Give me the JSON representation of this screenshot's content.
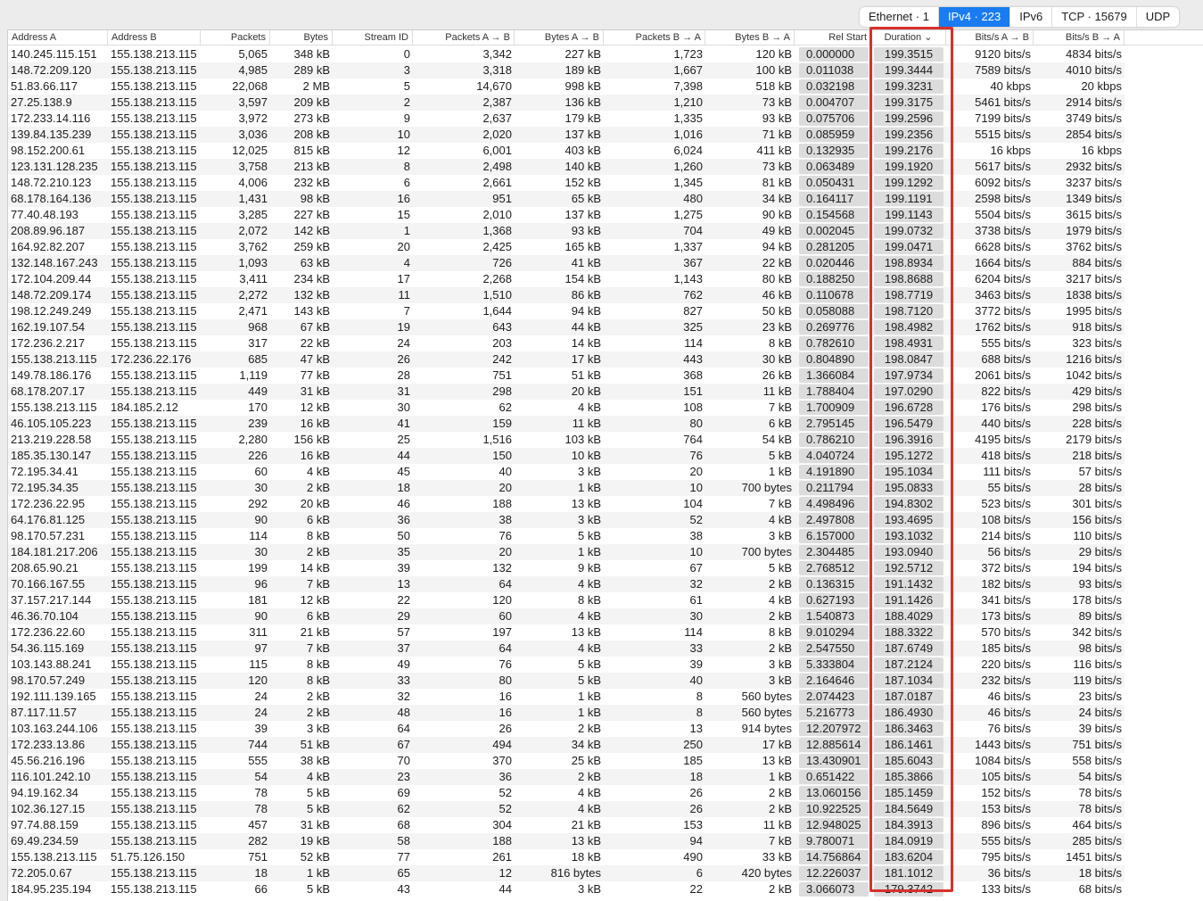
{
  "tabs": [
    {
      "label": "Ethernet · 1",
      "active": false
    },
    {
      "label": "IPv4 · 223",
      "active": true
    },
    {
      "label": "IPv6",
      "active": false
    },
    {
      "label": "TCP · 15679",
      "active": false
    },
    {
      "label": "UDP",
      "active": false
    }
  ],
  "accent": "#1a7cf0",
  "highlight_color": "#d9302c",
  "columns": [
    "Address A",
    "Address B",
    "Packets",
    "Bytes",
    "Stream ID",
    "Packets A → B",
    "Bytes A → B",
    "Packets B → A",
    "Bytes B → A",
    "Rel Start",
    "Duration ⌄",
    "Bits/s A → B",
    "Bits/s B → A"
  ],
  "rows": [
    [
      "140.245.115.151",
      "155.138.213.115",
      "5,065",
      "348 kB",
      "0",
      "3,342",
      "227 kB",
      "1,723",
      "120 kB",
      "0.000000",
      "199.3515",
      "9120 bits/s",
      "4834 bits/s"
    ],
    [
      "148.72.209.120",
      "155.138.213.115",
      "4,985",
      "289 kB",
      "3",
      "3,318",
      "189 kB",
      "1,667",
      "100 kB",
      "0.011038",
      "199.3444",
      "7589 bits/s",
      "4010 bits/s"
    ],
    [
      "51.83.66.117",
      "155.138.213.115",
      "22,068",
      "2 MB",
      "5",
      "14,670",
      "998 kB",
      "7,398",
      "518 kB",
      "0.032198",
      "199.3231",
      "40 kbps",
      "20 kbps"
    ],
    [
      "27.25.138.9",
      "155.138.213.115",
      "3,597",
      "209 kB",
      "2",
      "2,387",
      "136 kB",
      "1,210",
      "73 kB",
      "0.004707",
      "199.3175",
      "5461 bits/s",
      "2914 bits/s"
    ],
    [
      "172.233.14.116",
      "155.138.213.115",
      "3,972",
      "273 kB",
      "9",
      "2,637",
      "179 kB",
      "1,335",
      "93 kB",
      "0.075706",
      "199.2596",
      "7199 bits/s",
      "3749 bits/s"
    ],
    [
      "139.84.135.239",
      "155.138.213.115",
      "3,036",
      "208 kB",
      "10",
      "2,020",
      "137 kB",
      "1,016",
      "71 kB",
      "0.085959",
      "199.2356",
      "5515 bits/s",
      "2854 bits/s"
    ],
    [
      "98.152.200.61",
      "155.138.213.115",
      "12,025",
      "815 kB",
      "12",
      "6,001",
      "403 kB",
      "6,024",
      "411 kB",
      "0.132935",
      "199.2176",
      "16 kbps",
      "16 kbps"
    ],
    [
      "123.131.128.235",
      "155.138.213.115",
      "3,758",
      "213 kB",
      "8",
      "2,498",
      "140 kB",
      "1,260",
      "73 kB",
      "0.063489",
      "199.1920",
      "5617 bits/s",
      "2932 bits/s"
    ],
    [
      "148.72.210.123",
      "155.138.213.115",
      "4,006",
      "232 kB",
      "6",
      "2,661",
      "152 kB",
      "1,345",
      "81 kB",
      "0.050431",
      "199.1292",
      "6092 bits/s",
      "3237 bits/s"
    ],
    [
      "68.178.164.136",
      "155.138.213.115",
      "1,431",
      "98 kB",
      "16",
      "951",
      "65 kB",
      "480",
      "34 kB",
      "0.164117",
      "199.1191",
      "2598 bits/s",
      "1349 bits/s"
    ],
    [
      "77.40.48.193",
      "155.138.213.115",
      "3,285",
      "227 kB",
      "15",
      "2,010",
      "137 kB",
      "1,275",
      "90 kB",
      "0.154568",
      "199.1143",
      "5504 bits/s",
      "3615 bits/s"
    ],
    [
      "208.89.96.187",
      "155.138.213.115",
      "2,072",
      "142 kB",
      "1",
      "1,368",
      "93 kB",
      "704",
      "49 kB",
      "0.002045",
      "199.0732",
      "3738 bits/s",
      "1979 bits/s"
    ],
    [
      "164.92.82.207",
      "155.138.213.115",
      "3,762",
      "259 kB",
      "20",
      "2,425",
      "165 kB",
      "1,337",
      "94 kB",
      "0.281205",
      "199.0471",
      "6628 bits/s",
      "3762 bits/s"
    ],
    [
      "132.148.167.243",
      "155.138.213.115",
      "1,093",
      "63 kB",
      "4",
      "726",
      "41 kB",
      "367",
      "22 kB",
      "0.020446",
      "198.8934",
      "1664 bits/s",
      "884 bits/s"
    ],
    [
      "172.104.209.44",
      "155.138.213.115",
      "3,411",
      "234 kB",
      "17",
      "2,268",
      "154 kB",
      "1,143",
      "80 kB",
      "0.188250",
      "198.8688",
      "6204 bits/s",
      "3217 bits/s"
    ],
    [
      "148.72.209.174",
      "155.138.213.115",
      "2,272",
      "132 kB",
      "11",
      "1,510",
      "86 kB",
      "762",
      "46 kB",
      "0.110678",
      "198.7719",
      "3463 bits/s",
      "1838 bits/s"
    ],
    [
      "198.12.249.249",
      "155.138.213.115",
      "2,471",
      "143 kB",
      "7",
      "1,644",
      "94 kB",
      "827",
      "50 kB",
      "0.058088",
      "198.7120",
      "3772 bits/s",
      "1995 bits/s"
    ],
    [
      "162.19.107.54",
      "155.138.213.115",
      "968",
      "67 kB",
      "19",
      "643",
      "44 kB",
      "325",
      "23 kB",
      "0.269776",
      "198.4982",
      "1762 bits/s",
      "918 bits/s"
    ],
    [
      "172.236.2.217",
      "155.138.213.115",
      "317",
      "22 kB",
      "24",
      "203",
      "14 kB",
      "114",
      "8 kB",
      "0.782610",
      "198.4931",
      "555 bits/s",
      "323 bits/s"
    ],
    [
      "155.138.213.115",
      "172.236.22.176",
      "685",
      "47 kB",
      "26",
      "242",
      "17 kB",
      "443",
      "30 kB",
      "0.804890",
      "198.0847",
      "688 bits/s",
      "1216 bits/s"
    ],
    [
      "149.78.186.176",
      "155.138.213.115",
      "1,119",
      "77 kB",
      "28",
      "751",
      "51 kB",
      "368",
      "26 kB",
      "1.366084",
      "197.9734",
      "2061 bits/s",
      "1042 bits/s"
    ],
    [
      "68.178.207.17",
      "155.138.213.115",
      "449",
      "31 kB",
      "31",
      "298",
      "20 kB",
      "151",
      "11 kB",
      "1.788404",
      "197.0290",
      "822 bits/s",
      "429 bits/s"
    ],
    [
      "155.138.213.115",
      "184.185.2.12",
      "170",
      "12 kB",
      "30",
      "62",
      "4 kB",
      "108",
      "7 kB",
      "1.700909",
      "196.6728",
      "176 bits/s",
      "298 bits/s"
    ],
    [
      "46.105.105.223",
      "155.138.213.115",
      "239",
      "16 kB",
      "41",
      "159",
      "11 kB",
      "80",
      "6 kB",
      "2.795145",
      "196.5479",
      "440 bits/s",
      "228 bits/s"
    ],
    [
      "213.219.228.58",
      "155.138.213.115",
      "2,280",
      "156 kB",
      "25",
      "1,516",
      "103 kB",
      "764",
      "54 kB",
      "0.786210",
      "196.3916",
      "4195 bits/s",
      "2179 bits/s"
    ],
    [
      "185.35.130.147",
      "155.138.213.115",
      "226",
      "16 kB",
      "44",
      "150",
      "10 kB",
      "76",
      "5 kB",
      "4.040724",
      "195.1272",
      "418 bits/s",
      "218 bits/s"
    ],
    [
      "72.195.34.41",
      "155.138.213.115",
      "60",
      "4 kB",
      "45",
      "40",
      "3 kB",
      "20",
      "1 kB",
      "4.191890",
      "195.1034",
      "111 bits/s",
      "57 bits/s"
    ],
    [
      "72.195.34.35",
      "155.138.213.115",
      "30",
      "2 kB",
      "18",
      "20",
      "1 kB",
      "10",
      "700 bytes",
      "0.211794",
      "195.0833",
      "55 bits/s",
      "28 bits/s"
    ],
    [
      "172.236.22.95",
      "155.138.213.115",
      "292",
      "20 kB",
      "46",
      "188",
      "13 kB",
      "104",
      "7 kB",
      "4.498496",
      "194.8302",
      "523 bits/s",
      "301 bits/s"
    ],
    [
      "64.176.81.125",
      "155.138.213.115",
      "90",
      "6 kB",
      "36",
      "38",
      "3 kB",
      "52",
      "4 kB",
      "2.497808",
      "193.4695",
      "108 bits/s",
      "156 bits/s"
    ],
    [
      "98.170.57.231",
      "155.138.213.115",
      "114",
      "8 kB",
      "50",
      "76",
      "5 kB",
      "38",
      "3 kB",
      "6.157000",
      "193.1032",
      "214 bits/s",
      "110 bits/s"
    ],
    [
      "184.181.217.206",
      "155.138.213.115",
      "30",
      "2 kB",
      "35",
      "20",
      "1 kB",
      "10",
      "700 bytes",
      "2.304485",
      "193.0940",
      "56 bits/s",
      "29 bits/s"
    ],
    [
      "208.65.90.21",
      "155.138.213.115",
      "199",
      "14 kB",
      "39",
      "132",
      "9 kB",
      "67",
      "5 kB",
      "2.768512",
      "192.5712",
      "372 bits/s",
      "194 bits/s"
    ],
    [
      "70.166.167.55",
      "155.138.213.115",
      "96",
      "7 kB",
      "13",
      "64",
      "4 kB",
      "32",
      "2 kB",
      "0.136315",
      "191.1432",
      "182 bits/s",
      "93 bits/s"
    ],
    [
      "37.157.217.144",
      "155.138.213.115",
      "181",
      "12 kB",
      "22",
      "120",
      "8 kB",
      "61",
      "4 kB",
      "0.627193",
      "191.1426",
      "341 bits/s",
      "178 bits/s"
    ],
    [
      "46.36.70.104",
      "155.138.213.115",
      "90",
      "6 kB",
      "29",
      "60",
      "4 kB",
      "30",
      "2 kB",
      "1.540873",
      "188.4029",
      "173 bits/s",
      "89 bits/s"
    ],
    [
      "172.236.22.60",
      "155.138.213.115",
      "311",
      "21 kB",
      "57",
      "197",
      "13 kB",
      "114",
      "8 kB",
      "9.010294",
      "188.3322",
      "570 bits/s",
      "342 bits/s"
    ],
    [
      "54.36.115.169",
      "155.138.213.115",
      "97",
      "7 kB",
      "37",
      "64",
      "4 kB",
      "33",
      "2 kB",
      "2.547550",
      "187.6749",
      "185 bits/s",
      "98 bits/s"
    ],
    [
      "103.143.88.241",
      "155.138.213.115",
      "115",
      "8 kB",
      "49",
      "76",
      "5 kB",
      "39",
      "3 kB",
      "5.333804",
      "187.2124",
      "220 bits/s",
      "116 bits/s"
    ],
    [
      "98.170.57.249",
      "155.138.213.115",
      "120",
      "8 kB",
      "33",
      "80",
      "5 kB",
      "40",
      "3 kB",
      "2.164646",
      "187.1034",
      "232 bits/s",
      "119 bits/s"
    ],
    [
      "192.111.139.165",
      "155.138.213.115",
      "24",
      "2 kB",
      "32",
      "16",
      "1 kB",
      "8",
      "560 bytes",
      "2.074423",
      "187.0187",
      "46 bits/s",
      "23 bits/s"
    ],
    [
      "87.117.11.57",
      "155.138.213.115",
      "24",
      "2 kB",
      "48",
      "16",
      "1 kB",
      "8",
      "560 bytes",
      "5.216773",
      "186.4930",
      "46 bits/s",
      "24 bits/s"
    ],
    [
      "103.163.244.106",
      "155.138.213.115",
      "39",
      "3 kB",
      "64",
      "26",
      "2 kB",
      "13",
      "914 bytes",
      "12.207972",
      "186.3463",
      "76 bits/s",
      "39 bits/s"
    ],
    [
      "172.233.13.86",
      "155.138.213.115",
      "744",
      "51 kB",
      "67",
      "494",
      "34 kB",
      "250",
      "17 kB",
      "12.885614",
      "186.1461",
      "1443 bits/s",
      "751 bits/s"
    ],
    [
      "45.56.216.196",
      "155.138.213.115",
      "555",
      "38 kB",
      "70",
      "370",
      "25 kB",
      "185",
      "13 kB",
      "13.430901",
      "185.6043",
      "1084 bits/s",
      "558 bits/s"
    ],
    [
      "116.101.242.10",
      "155.138.213.115",
      "54",
      "4 kB",
      "23",
      "36",
      "2 kB",
      "18",
      "1 kB",
      "0.651422",
      "185.3866",
      "105 bits/s",
      "54 bits/s"
    ],
    [
      "94.19.162.34",
      "155.138.213.115",
      "78",
      "5 kB",
      "69",
      "52",
      "4 kB",
      "26",
      "2 kB",
      "13.060156",
      "185.1459",
      "152 bits/s",
      "78 bits/s"
    ],
    [
      "102.36.127.15",
      "155.138.213.115",
      "78",
      "5 kB",
      "62",
      "52",
      "4 kB",
      "26",
      "2 kB",
      "10.922525",
      "184.5649",
      "153 bits/s",
      "78 bits/s"
    ],
    [
      "97.74.88.159",
      "155.138.213.115",
      "457",
      "31 kB",
      "68",
      "304",
      "21 kB",
      "153",
      "11 kB",
      "12.948025",
      "184.3913",
      "896 bits/s",
      "464 bits/s"
    ],
    [
      "69.49.234.59",
      "155.138.213.115",
      "282",
      "19 kB",
      "58",
      "188",
      "13 kB",
      "94",
      "7 kB",
      "9.780071",
      "184.0919",
      "555 bits/s",
      "285 bits/s"
    ],
    [
      "155.138.213.115",
      "51.75.126.150",
      "751",
      "52 kB",
      "77",
      "261",
      "18 kB",
      "490",
      "33 kB",
      "14.756864",
      "183.6204",
      "795 bits/s",
      "1451 bits/s"
    ],
    [
      "72.205.0.67",
      "155.138.213.115",
      "18",
      "1 kB",
      "65",
      "12",
      "816 bytes",
      "6",
      "420 bytes",
      "12.226037",
      "181.1012",
      "36 bits/s",
      "18 bits/s"
    ],
    [
      "184.95.235.194",
      "155.138.213.115",
      "66",
      "5 kB",
      "43",
      "44",
      "3 kB",
      "22",
      "2 kB",
      "3.066073",
      "179.3742",
      "133 bits/s",
      "68 bits/s"
    ]
  ]
}
